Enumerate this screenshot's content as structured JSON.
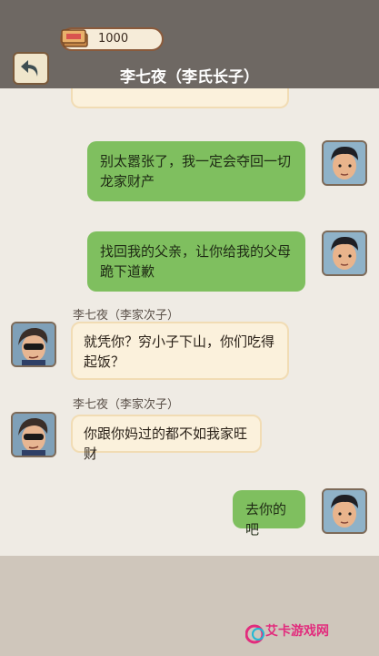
{
  "header": {
    "currency_value": "1000",
    "currency_icon": "cash-stack-icon",
    "back_icon": "back-arrow-icon",
    "title": "李七夜（李氏长子）"
  },
  "messages": [
    {
      "side": "me",
      "text": "别太嚣张了，我一定会夺回一切龙家财产"
    },
    {
      "side": "me",
      "text": "找回我的父亲，让你给我的父母跪下道歉"
    },
    {
      "side": "other",
      "sender": "李七夜（李家次子）",
      "text": "就凭你？穷小子下山，你们吃得起饭？"
    },
    {
      "side": "other",
      "sender": "李七夜（李家次子）",
      "text": "你跟你妈过的都不如我家旺财"
    },
    {
      "side": "me",
      "text": "去你的吧"
    }
  ],
  "watermark": {
    "text": "艾卡游戏网"
  },
  "colors": {
    "me_bubble": "#7fbf5f",
    "other_bubble": "#fbf1dc",
    "header_bg": "#6e6863"
  }
}
